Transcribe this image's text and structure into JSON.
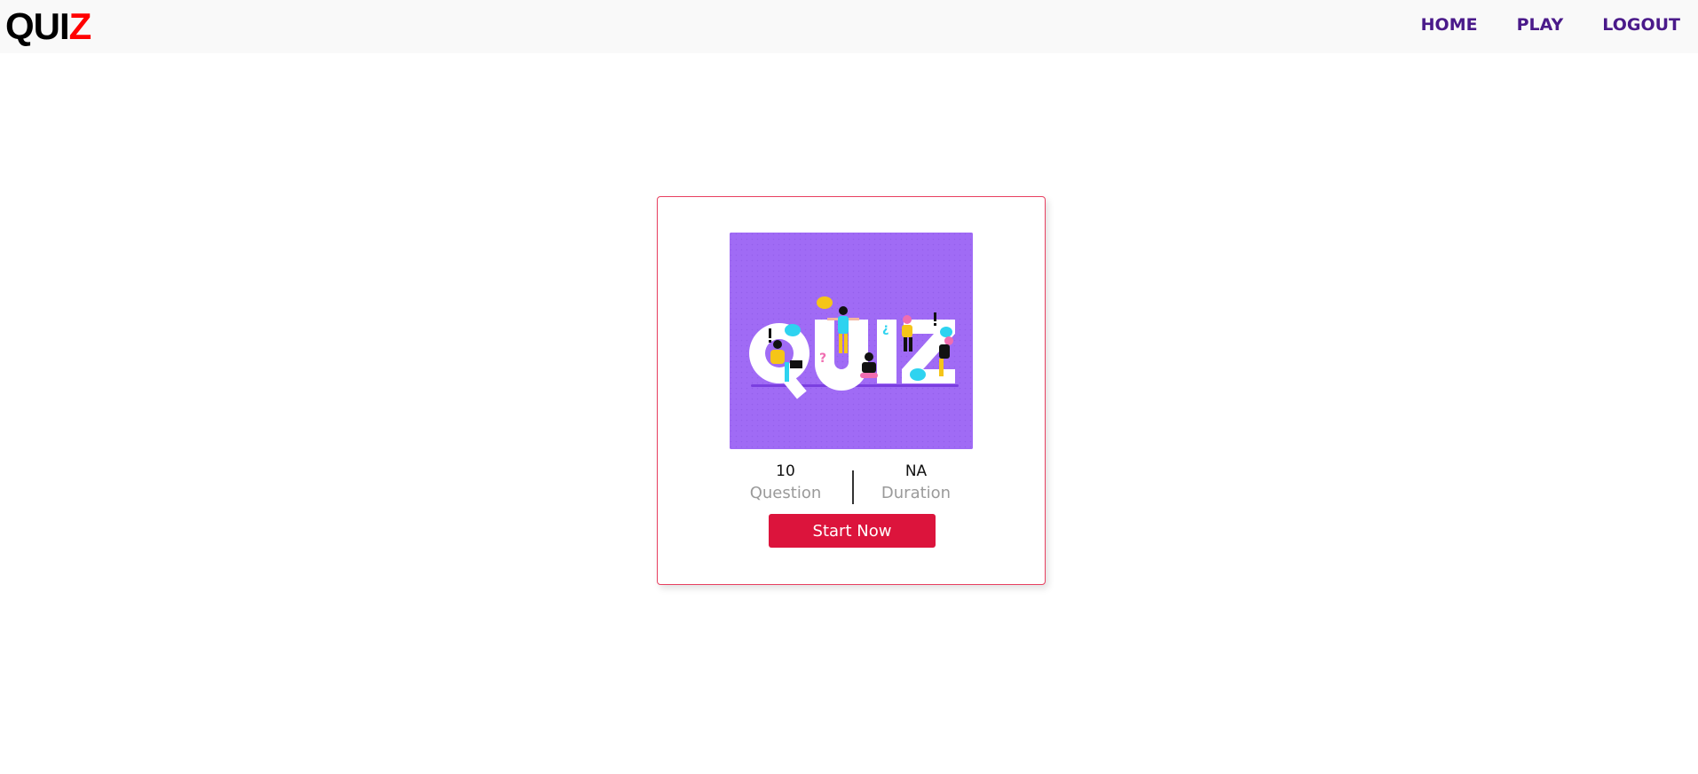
{
  "navbar": {
    "logo_main": "QUI",
    "logo_accent": "Z",
    "links": [
      "HOME",
      "PLAY",
      "LOGOUT"
    ]
  },
  "card": {
    "image_icon": "quiz-illustration",
    "questions_value": "10",
    "questions_label": "Question",
    "duration_value": "NA",
    "duration_label": "Duration",
    "start_label": "Start Now"
  },
  "colors": {
    "nav_link": "#4a1a8a",
    "logo_accent": "#ff0000",
    "card_border": "#e84060",
    "button": "#dc143c",
    "image_bg": "#a06bf5"
  }
}
